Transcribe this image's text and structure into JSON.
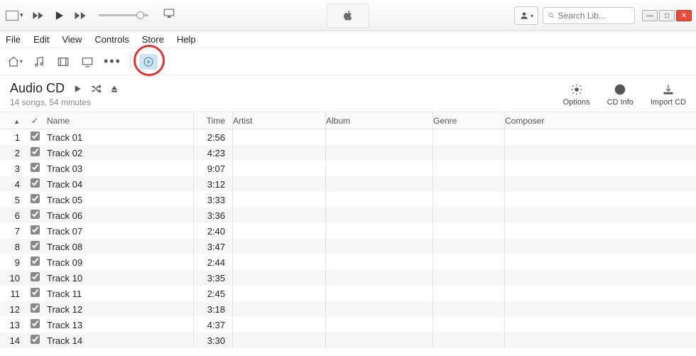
{
  "search": {
    "placeholder": "Search Lib..."
  },
  "menu": [
    "File",
    "Edit",
    "View",
    "Controls",
    "Store",
    "Help"
  ],
  "cd": {
    "title": "Audio CD",
    "subtitle": "14 songs, 54 minutes"
  },
  "actions": {
    "options": "Options",
    "cdinfo": "CD Info",
    "importcd": "Import CD"
  },
  "columns": {
    "check": "✓",
    "name": "Name",
    "time": "Time",
    "artist": "Artist",
    "album": "Album",
    "genre": "Genre",
    "composer": "Composer"
  },
  "tracks": [
    {
      "num": "1",
      "name": "Track 01",
      "time": "2:56"
    },
    {
      "num": "2",
      "name": "Track 02",
      "time": "4:23"
    },
    {
      "num": "3",
      "name": "Track 03",
      "time": "9:07"
    },
    {
      "num": "4",
      "name": "Track 04",
      "time": "3:12"
    },
    {
      "num": "5",
      "name": "Track 05",
      "time": "3:33"
    },
    {
      "num": "6",
      "name": "Track 06",
      "time": "3:36"
    },
    {
      "num": "7",
      "name": "Track 07",
      "time": "2:40"
    },
    {
      "num": "8",
      "name": "Track 08",
      "time": "3:47"
    },
    {
      "num": "9",
      "name": "Track 09",
      "time": "2:44"
    },
    {
      "num": "10",
      "name": "Track 10",
      "time": "3:35"
    },
    {
      "num": "11",
      "name": "Track 11",
      "time": "2:45"
    },
    {
      "num": "12",
      "name": "Track 12",
      "time": "3:18"
    },
    {
      "num": "13",
      "name": "Track 13",
      "time": "4:37"
    },
    {
      "num": "14",
      "name": "Track 14",
      "time": "3:30"
    }
  ]
}
